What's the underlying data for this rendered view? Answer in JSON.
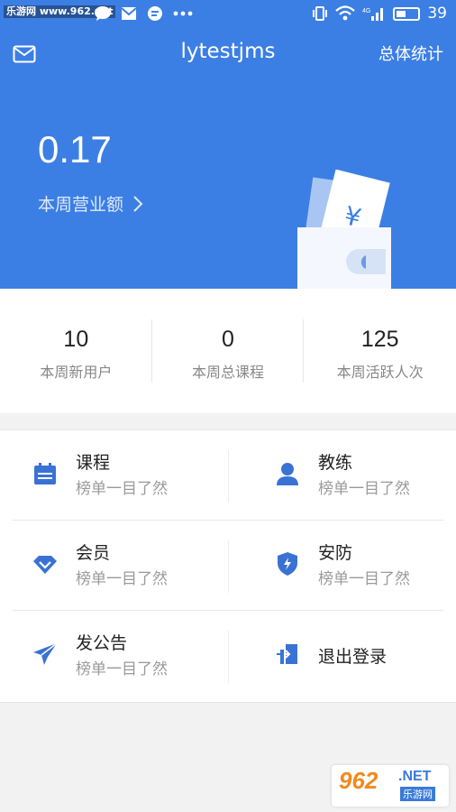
{
  "status_bar": {
    "watermark": "乐游网 www.962.net",
    "battery": "39"
  },
  "header": {
    "title": "lytestjms",
    "stats_link": "总体统计"
  },
  "revenue": {
    "value": "0.17",
    "label": "本周营业额"
  },
  "stats": [
    {
      "value": "10",
      "label": "本周新用户"
    },
    {
      "value": "0",
      "label": "本周总课程"
    },
    {
      "value": "125",
      "label": "本周活跃人次"
    }
  ],
  "menu": [
    {
      "title": "课程",
      "subtitle": "榜单一目了然",
      "icon": "calendar-icon"
    },
    {
      "title": "教练",
      "subtitle": "榜单一目了然",
      "icon": "person-icon"
    },
    {
      "title": "会员",
      "subtitle": "榜单一目了然",
      "icon": "diamond-icon"
    },
    {
      "title": "安防",
      "subtitle": "榜单一目了然",
      "icon": "shield-icon"
    },
    {
      "title": "发公告",
      "subtitle": "榜单一目了然",
      "icon": "paper-plane-icon"
    },
    {
      "title": "退出登录",
      "subtitle": "",
      "icon": "logout-icon"
    }
  ],
  "badge": {
    "brand": "962",
    "net": ".NET",
    "name": "乐游网"
  },
  "colors": {
    "primary": "#3c7fe4",
    "icon": "#3a72d4"
  }
}
